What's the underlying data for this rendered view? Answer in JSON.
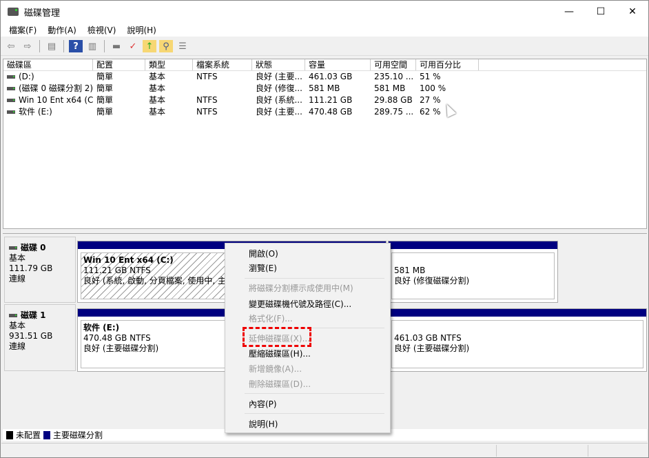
{
  "window": {
    "title": "磁碟管理",
    "min": "—",
    "max": "☐",
    "close": "✕"
  },
  "menu": [
    "檔案(F)",
    "動作(A)",
    "檢視(V)",
    "說明(H)"
  ],
  "columns": [
    "磁碟區",
    "配置",
    "類型",
    "檔案系統",
    "狀態",
    "容量",
    "可用空間",
    "可用百分比"
  ],
  "volumes": [
    {
      "name": "(D:)",
      "layout": "簡單",
      "type": "基本",
      "fs": "NTFS",
      "status": "良好 (主要...",
      "capacity": "461.03 GB",
      "free": "235.10 ...",
      "pct": "51 %"
    },
    {
      "name": "(磁碟 0 磁碟分割 2)",
      "layout": "簡單",
      "type": "基本",
      "fs": "",
      "status": "良好 (修復...",
      "capacity": "581 MB",
      "free": "581 MB",
      "pct": "100 %"
    },
    {
      "name": "Win 10 Ent x64 (C:)",
      "layout": "簡單",
      "type": "基本",
      "fs": "NTFS",
      "status": "良好 (系統...",
      "capacity": "111.21 GB",
      "free": "29.88 GB",
      "pct": "27 %"
    },
    {
      "name": "软件 (E:)",
      "layout": "簡單",
      "type": "基本",
      "fs": "NTFS",
      "status": "良好 (主要...",
      "capacity": "470.48 GB",
      "free": "289.75 ...",
      "pct": "62 %"
    }
  ],
  "disks": [
    {
      "name": "磁碟 0",
      "type": "基本",
      "size": "111.79 GB",
      "state": "連線",
      "parts": [
        {
          "title": "Win 10 Ent x64  (C:)",
          "size": "111.21 GB NTFS",
          "status": "良好 (系統, 啟動, 分頁檔案, 使用中, 主要磁碟分割)"
        },
        {
          "title": "",
          "size": "581 MB",
          "status": "良好 (修復磁碟分割)"
        }
      ]
    },
    {
      "name": "磁碟 1",
      "type": "基本",
      "size": "931.51 GB",
      "state": "連線",
      "parts": [
        {
          "title": "软件  (E:)",
          "size": "470.48 GB NTFS",
          "status": "良好 (主要磁碟分割)"
        },
        {
          "title": "",
          "size": "461.03 GB NTFS",
          "status": "良好 (主要磁碟分割)"
        }
      ]
    }
  ],
  "legend": [
    {
      "label": "未配置",
      "color": "#000000"
    },
    {
      "label": "主要磁碟分割",
      "color": "#000080"
    }
  ],
  "context_menu": [
    {
      "label": "開啟(O)",
      "enabled": true
    },
    {
      "label": "瀏覽(E)",
      "enabled": true
    },
    {
      "label": "將磁碟分割標示成使用中(M)",
      "enabled": false
    },
    {
      "label": "變更磁碟機代號及路徑(C)...",
      "enabled": true
    },
    {
      "label": "格式化(F)...",
      "enabled": false
    },
    {
      "label": "延伸磁碟區(X)...",
      "enabled": false
    },
    {
      "label": "壓縮磁碟區(H)...",
      "enabled": true
    },
    {
      "label": "新增鏡像(A)...",
      "enabled": false
    },
    {
      "label": "刪除磁碟區(D)...",
      "enabled": false
    },
    {
      "label": "內容(P)",
      "enabled": true
    },
    {
      "label": "說明(H)",
      "enabled": true
    }
  ]
}
